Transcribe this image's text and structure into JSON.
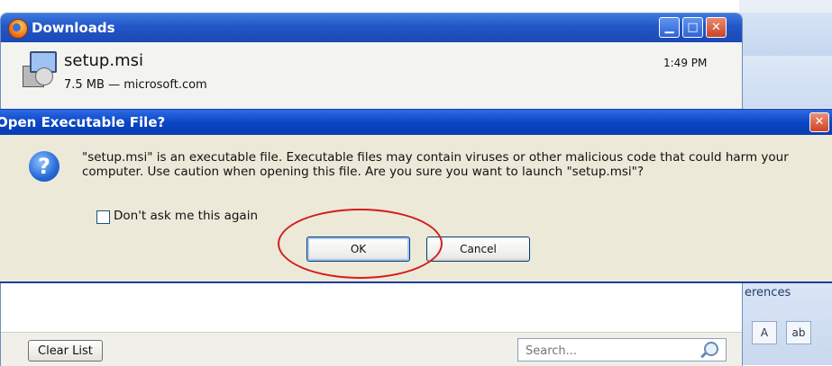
{
  "downloads_window": {
    "title": "Downloads",
    "item": {
      "file_name": "setup.msi",
      "meta": "7.5 MB — microsoft.com",
      "time": "1:49 PM"
    },
    "footer": {
      "clear_list_label": "Clear List",
      "search_placeholder": "Search..."
    }
  },
  "dialog": {
    "title": "Open Executable File?",
    "message": "\"setup.msi\" is an executable file. Executable files may contain viruses or other malicious code that could harm your computer. Use caution when opening this file. Are you sure you want to launch \"setup.msi\"?",
    "checkbox_label": "Don't ask me this again",
    "ok_label": "OK",
    "cancel_label": "Cancel"
  },
  "background_app": {
    "ribbon_text": "erences"
  },
  "colors": {
    "xp_titlebar_blue": "#0b46c6",
    "dialog_face": "#ece9d8",
    "highlight_circle": "#d21c1c"
  },
  "icons": [
    "firefox-icon",
    "minimize-icon",
    "maximize-icon",
    "close-icon",
    "msi-package-icon",
    "question-icon",
    "search-icon"
  ]
}
